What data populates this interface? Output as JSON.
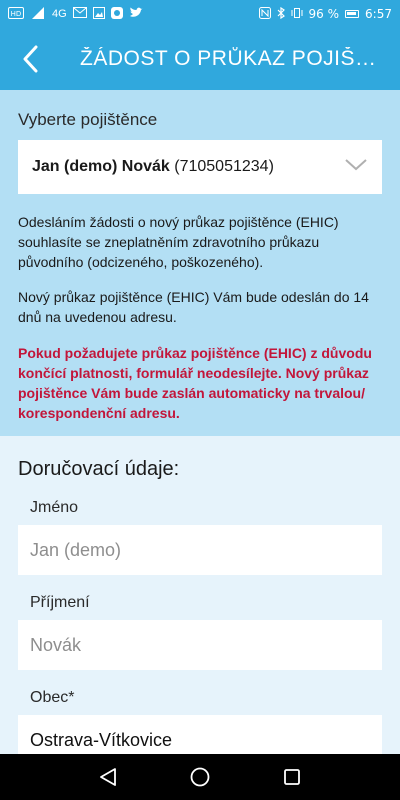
{
  "status_bar": {
    "left_icons": [
      "volte-icon",
      "signal-icon",
      "gmail-icon",
      "photo-icon",
      "app-icon",
      "twitter-icon"
    ],
    "signal_label": "4G",
    "battery": "96 %",
    "time": "6:57"
  },
  "app_bar": {
    "title": "ŽÁDOST O PRŮKAZ POJIŠTĚNCE"
  },
  "insured": {
    "label": "Vyberte pojištěnce",
    "selected_name": "Jan (demo) Novák",
    "selected_id": " (7105051234)"
  },
  "info": {
    "para1": "Odesláním žádosti o nový průkaz pojištěnce (EHIC) souhlasíte se zneplatněním zdravotního průkazu původního (odcizeného, poškozeného).",
    "para2": "Nový průkaz pojištěnce (EHIC) Vám bude odeslán do 14 dnů na uvedenou adresu.",
    "warning": "Pokud požadujete průkaz pojištěnce (EHIC) z důvodu končící platnosti, formulář neodesílejte. Nový průkaz pojištěnce Vám bude zaslán automaticky na trvalou/ korespondenční adresu."
  },
  "delivery": {
    "heading": "Doručovací údaje:",
    "first_name_label": "Jméno",
    "first_name_value": "Jan (demo)",
    "last_name_label": "Příjmení",
    "last_name_value": "Novák",
    "city_label": "Obec*",
    "city_value": "Ostrava-Vítkovice"
  },
  "colors": {
    "header": "#30a8dd",
    "info_bg": "#b3dff4",
    "form_bg": "#e6f3fb",
    "warning": "#c2163a"
  },
  "nav_bar": {
    "icons": [
      "back-triangle-icon",
      "home-circle-icon",
      "recents-square-icon"
    ]
  }
}
